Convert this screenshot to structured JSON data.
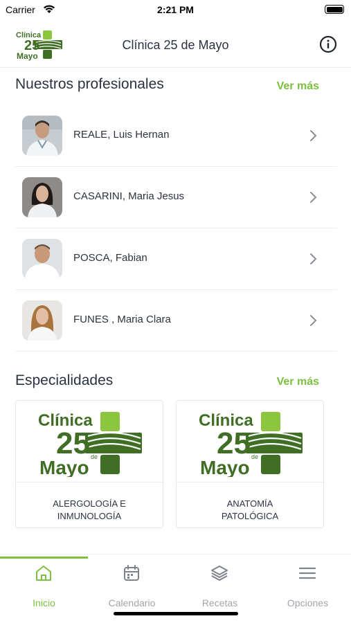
{
  "status": {
    "carrier": "Carrier",
    "time": "2:21 PM"
  },
  "header": {
    "title": "Clínica 25 de Mayo",
    "logo": {
      "line1": "Clínica",
      "line2": "25",
      "line3": "Mayo",
      "small": "de"
    }
  },
  "professionals": {
    "title": "Nuestros profesionales",
    "more_label": "Ver más",
    "items": [
      {
        "name": "REALE, Luis Hernan"
      },
      {
        "name": "CASARINI, Maria Jesus"
      },
      {
        "name": "POSCA, Fabian"
      },
      {
        "name": "FUNES , Maria Clara"
      }
    ]
  },
  "specialties": {
    "title": "Especialidades",
    "more_label": "Ver más",
    "items": [
      {
        "line1": "ALERGOLOGÍA E",
        "line2": "INMUNOLOGÍA"
      },
      {
        "line1": "ANATOMÍA",
        "line2": "PATOLÓGICA"
      }
    ]
  },
  "tabs": [
    {
      "label": "Inicio",
      "icon": "home-icon",
      "active": true
    },
    {
      "label": "Calendario",
      "icon": "calendar-icon",
      "active": false
    },
    {
      "label": "Recetas",
      "icon": "layers-icon",
      "active": false
    },
    {
      "label": "Opciones",
      "icon": "menu-icon",
      "active": false
    }
  ],
  "colors": {
    "accent": "#7cc040",
    "logo_dark": "#3f6e24",
    "logo_light": "#8cc63f",
    "text": "#2b3340",
    "inactive": "#a0a4ab"
  }
}
